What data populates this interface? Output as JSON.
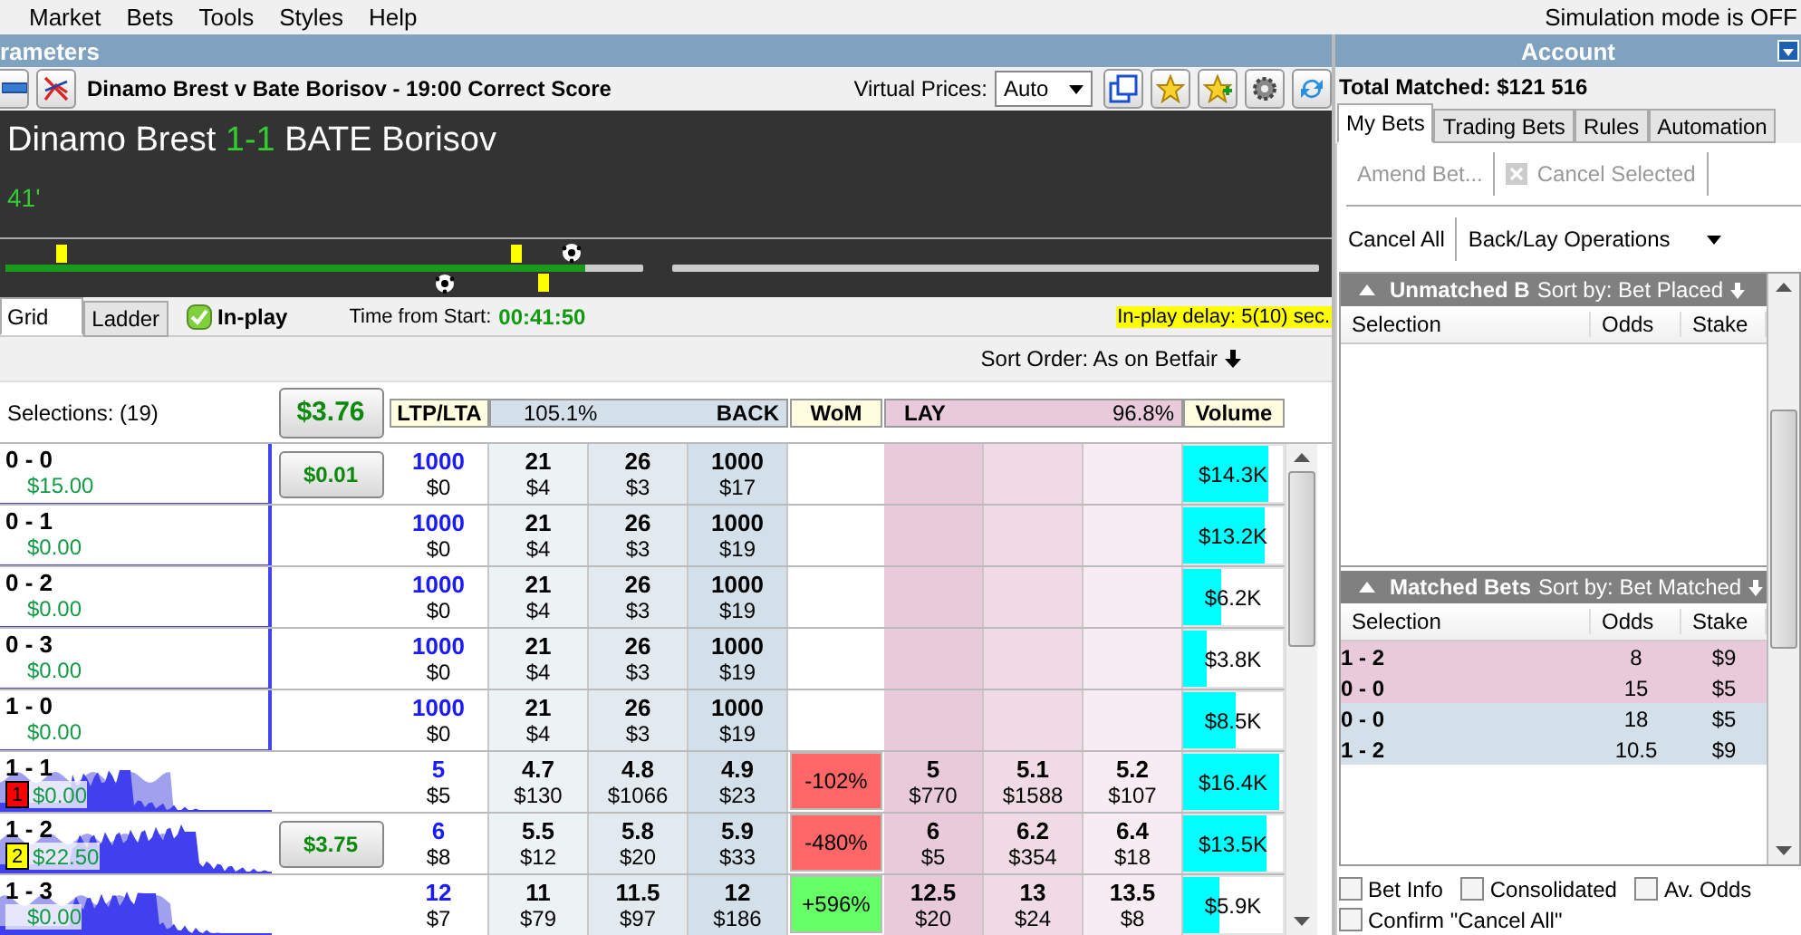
{
  "menu": [
    "Market",
    "Bets",
    "Tools",
    "Styles",
    "Help"
  ],
  "simulation_status": "Simulation mode is OFF",
  "left_title": "rameters",
  "right_title": "Account",
  "market": {
    "title": "Dinamo Brest v Bate Borisov - 19:00 Correct Score",
    "virtual_prices_label": "Virtual Prices:",
    "virtual_prices_value": "Auto"
  },
  "scoreboard": {
    "home": "Dinamo Brest",
    "score": "1-1",
    "away": "BATE Borisov",
    "minute": "41'"
  },
  "timeline": {
    "first_half": {
      "level": 0.91
    }
  },
  "view_tabs": [
    {
      "label": "Grid",
      "selected": true
    },
    {
      "label": "Ladder",
      "selected": false
    }
  ],
  "in_play": {
    "label": "In-play",
    "checked": true
  },
  "time_from_start": {
    "label": "Time from Start:",
    "value": "00:41:50"
  },
  "inplay_delay": "In-play delay: 5(10) sec.",
  "sort_order": "Sort Order: As on Betfair",
  "grid": {
    "selections_label": "Selections: (19)",
    "total_button": "$3.76",
    "headers": {
      "ltp": "LTP/LTA",
      "back_percent": "105.1%",
      "back": "BACK",
      "wom": "WoM",
      "lay": "LAY",
      "lay_percent": "96.8%",
      "volume": "Volume"
    },
    "rows": [
      {
        "name": "0 - 0",
        "profit": "$15.00",
        "cashout": "$0.01",
        "ltp": {
          "odds": "1000",
          "amount": "$0"
        },
        "back": [
          {
            "odds": "21",
            "amount": "$4"
          },
          {
            "odds": "26",
            "amount": "$3"
          },
          {
            "odds": "1000",
            "amount": "$17"
          }
        ],
        "volume": {
          "text": "$14.3K",
          "level": 0.86
        }
      },
      {
        "name": "0 - 1",
        "profit": "$0.00",
        "ltp": {
          "odds": "1000",
          "amount": "$0"
        },
        "back": [
          {
            "odds": "21",
            "amount": "$4"
          },
          {
            "odds": "26",
            "amount": "$3"
          },
          {
            "odds": "1000",
            "amount": "$19"
          }
        ],
        "volume": {
          "text": "$13.2K",
          "level": 0.81
        }
      },
      {
        "name": "0 - 2",
        "profit": "$0.00",
        "ltp": {
          "odds": "1000",
          "amount": "$0"
        },
        "back": [
          {
            "odds": "21",
            "amount": "$4"
          },
          {
            "odds": "26",
            "amount": "$3"
          },
          {
            "odds": "1000",
            "amount": "$19"
          }
        ],
        "volume": {
          "text": "$6.2K",
          "level": 0.38
        }
      },
      {
        "name": "0 - 3",
        "profit": "$0.00",
        "ltp": {
          "odds": "1000",
          "amount": "$0"
        },
        "back": [
          {
            "odds": "21",
            "amount": "$4"
          },
          {
            "odds": "26",
            "amount": "$3"
          },
          {
            "odds": "1000",
            "amount": "$19"
          }
        ],
        "volume": {
          "text": "$3.8K",
          "level": 0.23
        }
      },
      {
        "name": "1 - 0",
        "profit": "$0.00",
        "ltp": {
          "odds": "1000",
          "amount": "$0"
        },
        "back": [
          {
            "odds": "21",
            "amount": "$4"
          },
          {
            "odds": "26",
            "amount": "$3"
          },
          {
            "odds": "1000",
            "amount": "$19"
          }
        ],
        "volume": {
          "text": "$8.5K",
          "level": 0.52
        }
      },
      {
        "name": "1 - 1",
        "profit": "$0.00",
        "badge": {
          "text": "1",
          "color": "#ff0000"
        },
        "ltp": {
          "odds": "5",
          "amount": "$5"
        },
        "back": [
          {
            "odds": "4.7",
            "amount": "$130"
          },
          {
            "odds": "4.8",
            "amount": "$1066"
          },
          {
            "odds": "4.9",
            "amount": "$23"
          }
        ],
        "wom": {
          "text": "-102%",
          "color": "#ff6666"
        },
        "lay": [
          {
            "odds": "5",
            "amount": "$770"
          },
          {
            "odds": "5.1",
            "amount": "$1588"
          },
          {
            "odds": "5.2",
            "amount": "$107"
          }
        ],
        "volume": {
          "text": "$16.4K",
          "level": 0.97
        }
      },
      {
        "name": "1 - 2",
        "profit": "$22.50",
        "badge": {
          "text": "2",
          "color": "#ffff00"
        },
        "cashout": "$3.75",
        "ltp": {
          "odds": "6",
          "amount": "$8"
        },
        "back": [
          {
            "odds": "5.5",
            "amount": "$12"
          },
          {
            "odds": "5.8",
            "amount": "$20"
          },
          {
            "odds": "5.9",
            "amount": "$33"
          }
        ],
        "wom": {
          "text": "-480%",
          "color": "#ff6666"
        },
        "lay": [
          {
            "odds": "6",
            "amount": "$5"
          },
          {
            "odds": "6.2",
            "amount": "$354"
          },
          {
            "odds": "6.4",
            "amount": "$18"
          }
        ],
        "volume": {
          "text": "$13.5K",
          "level": 0.83
        }
      },
      {
        "name": "1 - 3",
        "profit": "$0.00",
        "ltp": {
          "odds": "12",
          "amount": "$7"
        },
        "back": [
          {
            "odds": "11",
            "amount": "$79"
          },
          {
            "odds": "11.5",
            "amount": "$97"
          },
          {
            "odds": "12",
            "amount": "$186"
          }
        ],
        "wom": {
          "text": "+596%",
          "color": "#66ff66"
        },
        "lay": [
          {
            "odds": "12.5",
            "amount": "$20"
          },
          {
            "odds": "13",
            "amount": "$24"
          },
          {
            "odds": "13.5",
            "amount": "$8"
          }
        ],
        "volume": {
          "text": "$5.9K",
          "level": 0.36
        }
      }
    ]
  },
  "account": {
    "total_matched": "Total Matched: $121 516",
    "tabs": [
      {
        "label": "My Bets",
        "selected": true
      },
      {
        "label": "Trading Bets",
        "selected": false
      },
      {
        "label": "Rules",
        "selected": false
      },
      {
        "label": "Automation",
        "selected": false
      }
    ],
    "amend": {
      "label": "Amend Bet...",
      "disabled": true
    },
    "cancel_selected": {
      "label": "Cancel Selected",
      "disabled": true
    },
    "cancel_all": "Cancel All",
    "operations": "Back/Lay Operations",
    "unmatched": {
      "title": "Unmatched B",
      "sort": "Sort by: Bet Placed",
      "columns": [
        "Selection",
        "Odds",
        "Stake"
      ]
    },
    "matched": {
      "title": "Matched Bets",
      "sort": "Sort by: Bet Matched",
      "columns": [
        "Selection",
        "Odds",
        "Stake"
      ],
      "rows": [
        {
          "selection": "1 - 2",
          "odds": "8",
          "stake": "$9",
          "kind": "lay"
        },
        {
          "selection": "0 - 0",
          "odds": "15",
          "stake": "$5",
          "kind": "lay"
        },
        {
          "selection": "0 - 0",
          "odds": "18",
          "stake": "$5",
          "kind": "back"
        },
        {
          "selection": "1 - 2",
          "odds": "10.5",
          "stake": "$9",
          "kind": "back"
        }
      ]
    },
    "options": [
      {
        "label": "Bet Info",
        "checked": false
      },
      {
        "label": "Consolidated",
        "checked": false
      },
      {
        "label": "Av. Odds",
        "checked": false
      },
      {
        "label": "Confirm \"Cancel All\"",
        "checked": false
      }
    ]
  }
}
